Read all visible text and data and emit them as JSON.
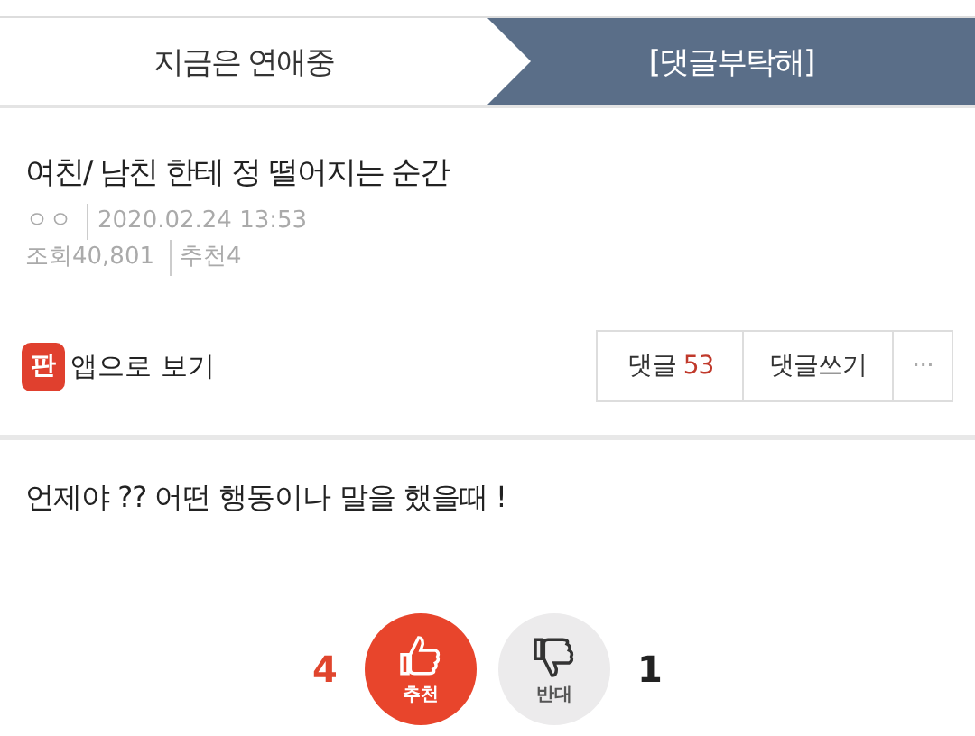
{
  "tabs": [
    {
      "label": "지금은 연애중",
      "selected": false
    },
    {
      "label": "[댓글부탁해]",
      "selected": true
    }
  ],
  "post": {
    "title": "여친/ 남친 한테 정 떨어지는 순간",
    "author": "ㅇㅇ",
    "date": "2020.02.24 13:53",
    "views": "조회40,801",
    "recommend": "추천4"
  },
  "app_link": {
    "icon_text": "판",
    "label": "앱으로 보기"
  },
  "actions": {
    "comments_label": "댓글",
    "comments_count": "53",
    "write_label": "댓글쓰기",
    "more": "···"
  },
  "body": "언제야 ?? 어떤 행동이나 말을 했을때 !",
  "votes": [
    {
      "kind": "up",
      "label": "추천",
      "count": "4",
      "selected": true
    },
    {
      "kind": "down",
      "label": "반대",
      "count": "1",
      "selected": false
    }
  ]
}
